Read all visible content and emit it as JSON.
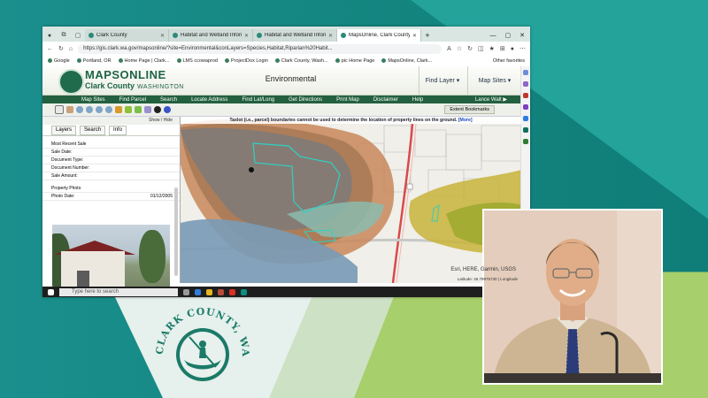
{
  "browser": {
    "tabs": [
      {
        "label": "Clark County",
        "active": false
      },
      {
        "label": "Habitat and Wetland Informat",
        "active": false
      },
      {
        "label": "Habitat and Wetland Informat",
        "active": false
      },
      {
        "label": "MapsOnline, Clark County W",
        "active": true
      }
    ],
    "new_tab": "+",
    "url": "https://gis.clark.wa.gov/mapsonline/?site=Environmental&conLayers=Species,Habitat,Riparian%20Habit...",
    "favorites": [
      "Google",
      "Portland, OR",
      "Home Page | Clark...",
      "LMS ccowaprod",
      "ProjectDox Login",
      "Clark County, Wash...",
      "pic Home Page",
      "MapsOnline, Clark..."
    ],
    "other_favorites": "Other favorites"
  },
  "mapsonline": {
    "logo_title": "MAPSONLINE",
    "logo_sub_county": "Clark County",
    "logo_sub_state": "WASHINGTON",
    "site_name": "Environmental",
    "find_layer": "Find Layer ▾",
    "map_sites": "Map Sites ▾",
    "menu": [
      "Map Sites",
      "Find Parcel",
      "Search",
      "Locate Address",
      "Find Lat/Long",
      "Get Directions",
      "Print Map",
      "Disclaimer",
      "Help"
    ],
    "user": "Lance Walt ▶",
    "extent_bookmarks": "Extent Bookmarks",
    "notice": "Taxlot (i.e., parcel) boundaries cannot be used to determine the location of property lines on the ground.",
    "notice_more": "[More]",
    "attribution": "Esri, HERE, Garmin, USGS",
    "latlong": "Latitude: 45.79975730 | Longitude"
  },
  "left_panel": {
    "show_hide": "Show / Hide",
    "tabs": [
      "Layers",
      "Search",
      "Info"
    ],
    "rows": [
      {
        "label": "Most Recent Sale",
        "value": ""
      },
      {
        "label": "Sale Date:",
        "value": ""
      },
      {
        "label": "Document Type:",
        "value": ""
      },
      {
        "label": "Document Number:",
        "value": ""
      },
      {
        "label": "Sale Amount:",
        "value": ""
      }
    ],
    "photo_title": "Property Photo",
    "photo_date_label": "Photo Date:",
    "photo_date": "01/12/2005"
  },
  "taskbar": {
    "search_placeholder": "Type here to search"
  },
  "seal": {
    "text_top": "CLARK COUNTY, WASHINGTON"
  },
  "colors": {
    "header_green": "#23603f",
    "brand_teal": "#1a8f8d",
    "accent_lime": "#a7cf6b"
  }
}
